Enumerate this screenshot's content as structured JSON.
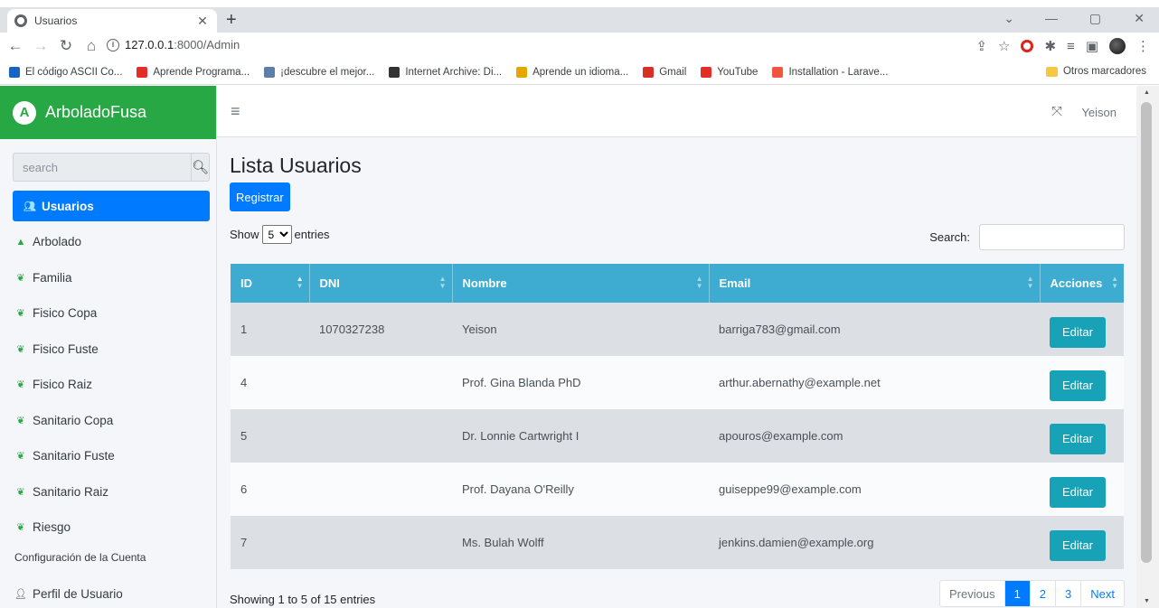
{
  "browser": {
    "tab_title": "Usuarios",
    "url_host": "127.0.0.1",
    "url_path": ":8000/Admin",
    "bookmarks": [
      {
        "label": "El código ASCII Co...",
        "color": "#1565c0"
      },
      {
        "label": "Aprende Programa...",
        "color": "#e52d27"
      },
      {
        "label": "¡descubre el mejor...",
        "color": "#5b7fa6"
      },
      {
        "label": "Internet Archive: Di...",
        "color": "#333333"
      },
      {
        "label": "Aprende un idioma...",
        "color": "#e6a800"
      },
      {
        "label": "Gmail",
        "color": "#d93025"
      },
      {
        "label": "YouTube",
        "color": "#e52d27"
      },
      {
        "label": "Installation - Larave...",
        "color": "#f0553f"
      }
    ],
    "other_bookmarks": "Otros marcadores"
  },
  "app": {
    "brand": "ArboladoFusa",
    "brand_logo_letter": "A",
    "user": "Yeison",
    "search_placeholder": "search",
    "menu": [
      {
        "label": "Usuarios",
        "icon": "users-icon",
        "active": true
      },
      {
        "label": "Arbolado",
        "icon": "tree-icon",
        "active": false
      },
      {
        "label": "Familia",
        "icon": "seedling-icon",
        "active": false
      },
      {
        "label": "Fisico Copa",
        "icon": "seedling-icon",
        "active": false
      },
      {
        "label": "Fisico Fuste",
        "icon": "seedling-icon",
        "active": false
      },
      {
        "label": "Fisico Raiz",
        "icon": "seedling-icon",
        "active": false
      },
      {
        "label": "Sanitario Copa",
        "icon": "seedling-icon",
        "active": false
      },
      {
        "label": "Sanitario Fuste",
        "icon": "seedling-icon",
        "active": false
      },
      {
        "label": "Sanitario Raiz",
        "icon": "seedling-icon",
        "active": false
      },
      {
        "label": "Riesgo",
        "icon": "seedling-icon",
        "active": false
      }
    ],
    "menu_header": "Configuración de la Cuenta",
    "profile_item": "Perfil de Usuario"
  },
  "page": {
    "title": "Lista Usuarios",
    "register_label": "Registrar",
    "show_label": "Show",
    "entries_label": "entries",
    "page_size": "5",
    "search_label": "Search:",
    "columns": [
      "ID",
      "DNI",
      "Nombre",
      "Email",
      "Acciones"
    ],
    "rows": [
      {
        "id": "1",
        "dni": "1070327238",
        "nombre": "Yeison",
        "email": "barriga783@gmail.com"
      },
      {
        "id": "4",
        "dni": "",
        "nombre": "Prof. Gina Blanda PhD",
        "email": "arthur.abernathy@example.net"
      },
      {
        "id": "5",
        "dni": "",
        "nombre": "Dr. Lonnie Cartwright I",
        "email": "apouros@example.com"
      },
      {
        "id": "6",
        "dni": "",
        "nombre": "Prof. Dayana O'Reilly",
        "email": "guiseppe99@example.com"
      },
      {
        "id": "7",
        "dni": "",
        "nombre": "Ms. Bulah Wolff",
        "email": "jenkins.damien@example.org"
      }
    ],
    "edit_label": "Editar",
    "info": "Showing 1 to 5 of 15 entries",
    "pagination": {
      "previous": "Previous",
      "pages": [
        "1",
        "2",
        "3"
      ],
      "current": "1",
      "next": "Next"
    }
  }
}
